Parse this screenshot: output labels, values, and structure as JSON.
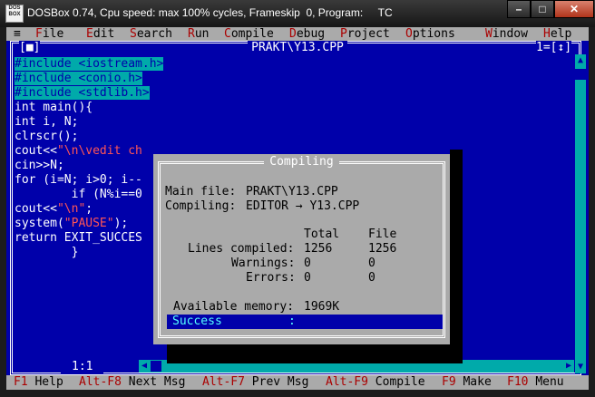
{
  "window": {
    "title": "DOSBox 0.74, Cpu speed: max 100% cycles, Frameskip  0, Program:     TC",
    "icon_text": "DOS BOX"
  },
  "menu": {
    "system": "≡",
    "items": [
      {
        "hot": "F",
        "rest": "ile"
      },
      {
        "hot": "E",
        "rest": "dit"
      },
      {
        "hot": "S",
        "rest": "earch"
      },
      {
        "hot": "R",
        "rest": "un"
      },
      {
        "hot": "C",
        "rest": "ompile"
      },
      {
        "hot": "D",
        "rest": "ebug"
      },
      {
        "hot": "P",
        "rest": "roject"
      },
      {
        "hot": "O",
        "rest": "ptions"
      },
      {
        "hot": "W",
        "rest": "indow"
      },
      {
        "hot": "H",
        "rest": "elp"
      }
    ]
  },
  "editor": {
    "filename": "PRAKT\\Y13.CPP",
    "close_box": "[■]",
    "window_number": "1=[↕]",
    "position": "1:1",
    "lines": [
      {
        "type": "hl",
        "text": "#include <iostream.h>"
      },
      {
        "type": "hl",
        "text": "#include <conio.h>"
      },
      {
        "type": "hl",
        "text": "#include <stdlib.h>"
      },
      {
        "type": "plain",
        "text": "int main(){"
      },
      {
        "type": "plain",
        "text": "int i, N;"
      },
      {
        "type": "plain",
        "text": "clrscr();"
      },
      {
        "type": "mixed",
        "pre": "cout<<",
        "str": "\"\\n\\vedit ch",
        "post": ""
      },
      {
        "type": "plain",
        "text": "cin>>N;"
      },
      {
        "type": "plain",
        "text": "for (i=N; i>0; i--"
      },
      {
        "type": "plain",
        "text": "        if (N%i==0"
      },
      {
        "type": "mixed",
        "pre": "cout<<",
        "str": "\"\\n\"",
        "post": ";"
      },
      {
        "type": "mixed",
        "pre": "system(",
        "str": "\"PAUSE\"",
        "post": ");"
      },
      {
        "type": "plain",
        "text": "return EXIT_SUCCES"
      },
      {
        "type": "plain",
        "text": "        }"
      }
    ]
  },
  "dialog": {
    "title": "Compiling",
    "main_file_label": "Main file:",
    "main_file": "PRAKT\\Y13.CPP",
    "compiling_label": "Compiling:",
    "compiling": "EDITOR → Y13.CPP",
    "col_total": "Total",
    "col_file": "File",
    "lines_label": "Lines compiled:",
    "lines_total": "1256",
    "lines_file": "1256",
    "warnings_label": "Warnings:",
    "warnings_total": "0",
    "warnings_file": "0",
    "errors_label": "Errors:",
    "errors_total": "0",
    "errors_file": "0",
    "memory_label": "Available memory:",
    "memory_value": "1969K",
    "status_label": "Success",
    "status_sep": ":"
  },
  "statusbar": [
    {
      "key": "F1",
      "label": "Help"
    },
    {
      "key": "Alt-F8",
      "label": "Next Msg"
    },
    {
      "key": "Alt-F7",
      "label": "Prev Msg"
    },
    {
      "key": "Alt-F9",
      "label": "Compile"
    },
    {
      "key": "F9",
      "label": "Make"
    },
    {
      "key": "F10",
      "label": "Menu"
    }
  ],
  "colors": {
    "editor_bg": "#0000aa",
    "menu_bg": "#aaaaaa",
    "hotkey": "#aa0000",
    "highlight": "#00aaaa",
    "string": "#ff5555"
  }
}
